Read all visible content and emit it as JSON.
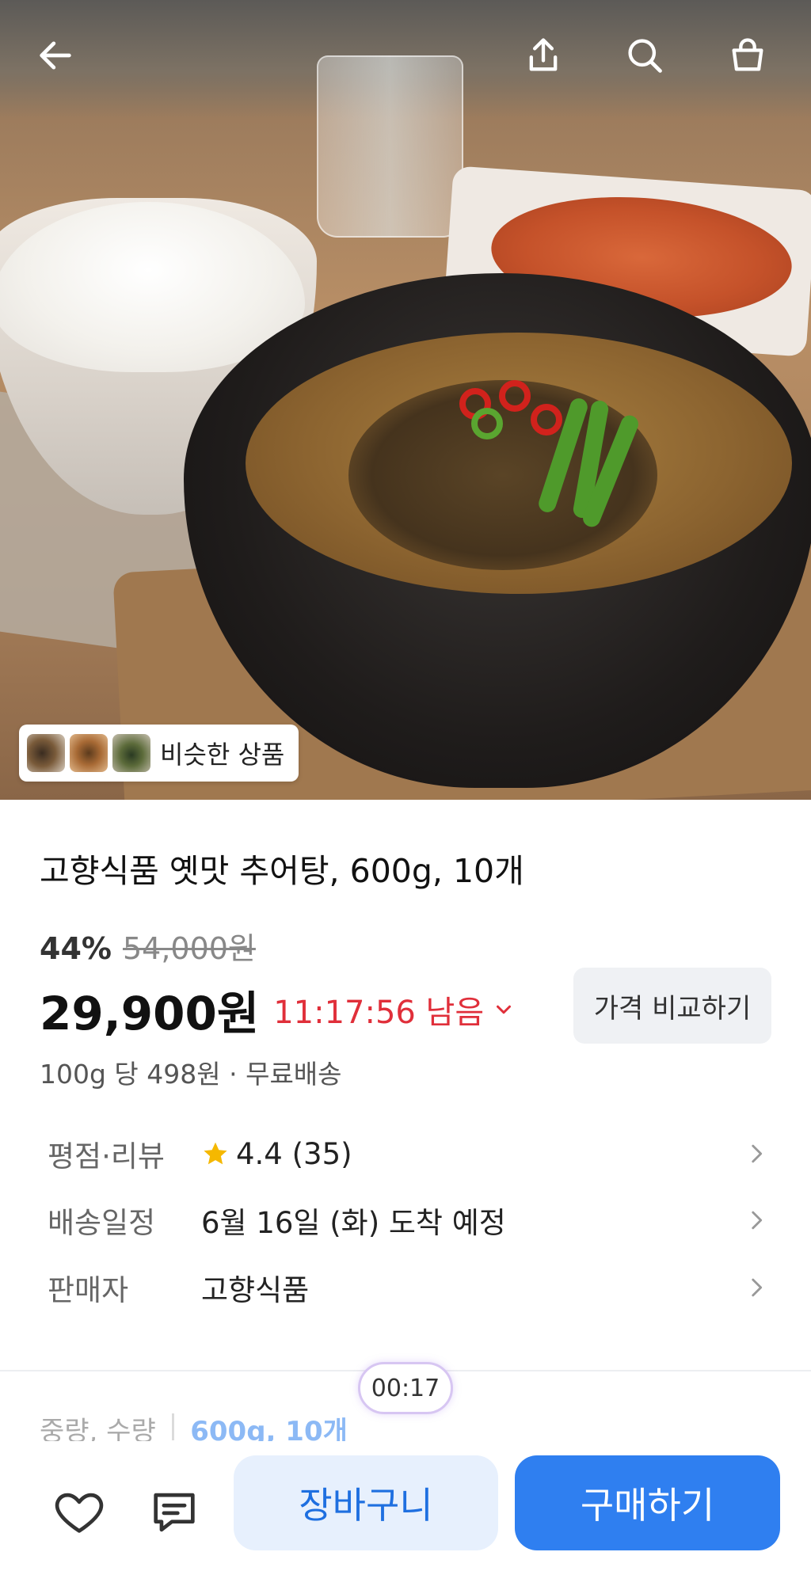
{
  "hero": {
    "similar_label": "비슷한 상품"
  },
  "product": {
    "title": "고향식품 옛맛 추어탕, 600g, 10개",
    "discount_rate": "44%",
    "original_price": "54,000원",
    "price": "29,900원",
    "countdown": "11:17:56 남음",
    "compare_label": "가격 비교하기",
    "unit_price": "100g 당 498원 · 무료배송"
  },
  "info": {
    "rating_key": "평점·리뷰",
    "rating_value": "4.4 (35)",
    "delivery_key": "배송일정",
    "delivery_value": "6월 16일 (화) 도착 예정",
    "seller_key": "판매자",
    "seller_value": "고향식품"
  },
  "spec": {
    "key": "중량, 수량",
    "value": "600g, 10개"
  },
  "timer": "00:17",
  "bottom_bar": {
    "cart_label": "장바구니",
    "buy_label": "구매하기"
  },
  "colors": {
    "accent_blue": "#2f7ff0",
    "countdown_red": "#e02f3a",
    "star_yellow": "#f5b800"
  }
}
